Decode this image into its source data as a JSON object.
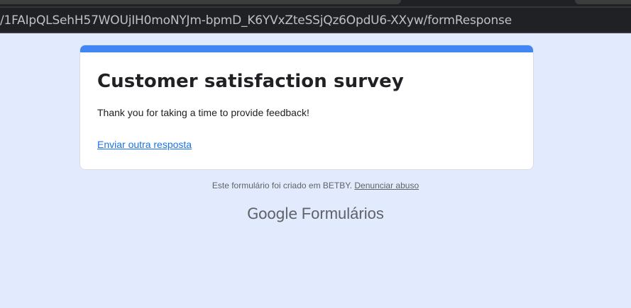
{
  "browser": {
    "url": "/1FAIpQLSehH57WOUjIH0moNYJm-bpmD_K6YVxZteSSjQz6OpdU6-XXyw/formResponse"
  },
  "form": {
    "title": "Customer satisfaction survey",
    "confirmation_message": "Thank you for taking a time to provide feedback!",
    "submit_another_link": "Enviar outra resposta",
    "accent_color": "#4285f4"
  },
  "footer": {
    "created_by_text": "Este formulário foi criado em BETBY.",
    "report_abuse_link": "Denunciar abuso"
  },
  "brand": {
    "google": "Google",
    "product": "Formulários"
  }
}
